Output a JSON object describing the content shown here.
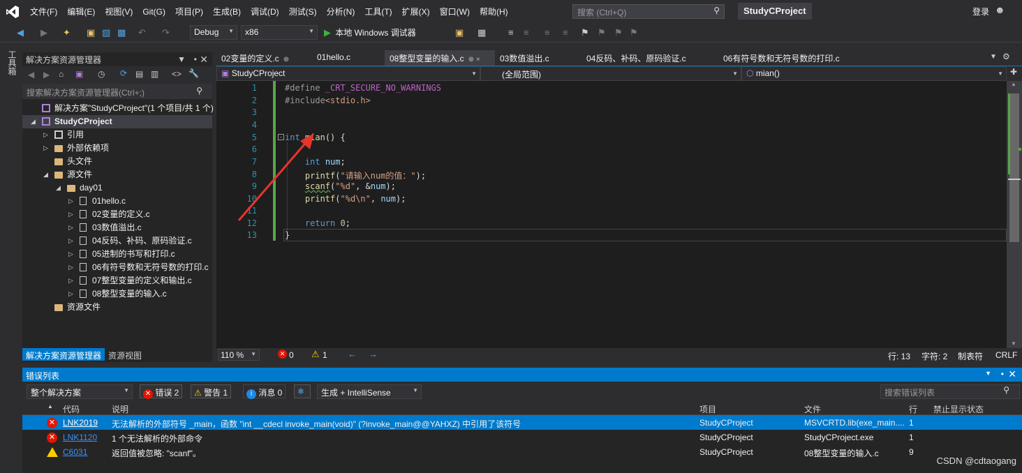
{
  "menubar": {
    "items": [
      "文件(F)",
      "编辑(E)",
      "视图(V)",
      "Git(G)",
      "项目(P)",
      "生成(B)",
      "调试(D)",
      "测试(S)",
      "分析(N)",
      "工具(T)",
      "扩展(X)",
      "窗口(W)",
      "帮助(H)"
    ],
    "search_placeholder": "搜索 (Ctrl+Q)",
    "project": "StudyCProject",
    "login": "登录"
  },
  "toolbar": {
    "config": "Debug",
    "platform": "x86",
    "run_label": "本地 Windows 调试器"
  },
  "left_tool_label": "工具箱",
  "solution_explorer": {
    "title": "解决方案资源管理器",
    "search_placeholder": "搜索解决方案资源管理器(Ctrl+;)",
    "tree": [
      {
        "label": "解决方案\"StudyCProject\"(1 个项目/共 1 个)",
        "level": 0,
        "expand": "",
        "icon": "solution-icon"
      },
      {
        "label": "StudyCProject",
        "level": 0,
        "expand": "◢",
        "icon": "project-icon",
        "selected": true
      },
      {
        "label": "引用",
        "level": 1,
        "expand": "▷",
        "icon": "references-icon"
      },
      {
        "label": "外部依赖项",
        "level": 1,
        "expand": "▷",
        "icon": "folder-icon"
      },
      {
        "label": "头文件",
        "level": 1,
        "expand": "",
        "icon": "folder-icon"
      },
      {
        "label": "源文件",
        "level": 1,
        "expand": "◢",
        "icon": "folder-icon"
      },
      {
        "label": "day01",
        "level": 2,
        "expand": "◢",
        "icon": "folder-icon"
      },
      {
        "label": "01hello.c",
        "level": 3,
        "expand": "▷",
        "icon": "c-file-icon"
      },
      {
        "label": "02变量的定义.c",
        "level": 3,
        "expand": "▷",
        "icon": "c-file-icon"
      },
      {
        "label": "03数值溢出.c",
        "level": 3,
        "expand": "▷",
        "icon": "c-file-icon"
      },
      {
        "label": "04反码、补码、原码验证.c",
        "level": 3,
        "expand": "▷",
        "icon": "c-file-icon"
      },
      {
        "label": "05进制的书写和打印.c",
        "level": 3,
        "expand": "▷",
        "icon": "c-file-icon"
      },
      {
        "label": "06有符号数和无符号数的打印.c",
        "level": 3,
        "expand": "▷",
        "icon": "c-file-icon"
      },
      {
        "label": "07整型变量的定义和输出.c",
        "level": 3,
        "expand": "▷",
        "icon": "c-file-icon"
      },
      {
        "label": "08整型变量的输入.c",
        "level": 3,
        "expand": "▷",
        "icon": "c-file-icon"
      },
      {
        "label": "资源文件",
        "level": 1,
        "expand": "",
        "icon": "folder-icon"
      }
    ],
    "tabs": [
      "解决方案资源管理器",
      "资源视图"
    ]
  },
  "doc_tabs": [
    {
      "label": "02变量的定义.c",
      "pin": "⊕"
    },
    {
      "label": "01hello.c",
      "pin": ""
    },
    {
      "label": "08整型变量的输入.c",
      "pin": "⊕ ×",
      "active": true
    },
    {
      "label": "03数值溢出.c",
      "pin": ""
    },
    {
      "label": "04反码、补码、原码验证.c",
      "pin": ""
    },
    {
      "label": "06有符号数和无符号数的打印.c",
      "pin": ""
    }
  ],
  "navbar": {
    "project": "StudyCProject",
    "scope": "(全局范围)",
    "member": "mian()"
  },
  "code_lines": [
    "1",
    "2",
    "3",
    "4",
    "5",
    "6",
    "7",
    "8",
    "9",
    "10",
    "11",
    "12",
    "13"
  ],
  "editor_status": {
    "zoom": "110 %",
    "errors": "0",
    "warnings": "1",
    "line": "行: 13",
    "char": "字符: 2",
    "tabs": "制表符",
    "eol": "CRLF"
  },
  "error_list": {
    "title": "错误列表",
    "scope": "整个解决方案",
    "errors_btn": "错误 2",
    "warnings_btn": "警告 1",
    "messages_btn": "消息 0",
    "build_filter": "生成 + IntelliSense",
    "search_placeholder": "搜索错误列表",
    "columns": [
      "代码",
      "说明",
      "项目",
      "文件",
      "行",
      "禁止显示状态"
    ],
    "rows": [
      {
        "type": "error",
        "code": "LNK2019",
        "desc": "无法解析的外部符号 _main，函数 \"int __cdecl invoke_main(void)\" (?invoke_main@@YAHXZ) 中引用了该符号",
        "project": "StudyCProject",
        "file": "MSVCRTD.lib(exe_main....",
        "line": "1",
        "selected": true
      },
      {
        "type": "error",
        "code": "LNK1120",
        "desc": "1 个无法解析的外部命令",
        "project": "StudyCProject",
        "file": "StudyCProject.exe",
        "line": "1"
      },
      {
        "type": "warning",
        "code": "C6031",
        "desc": "返回值被忽略: \"scanf\"。",
        "project": "StudyCProject",
        "file": "08整型变量的输入.c",
        "line": "9"
      }
    ]
  },
  "watermark": "CSDN @cdtaogang"
}
